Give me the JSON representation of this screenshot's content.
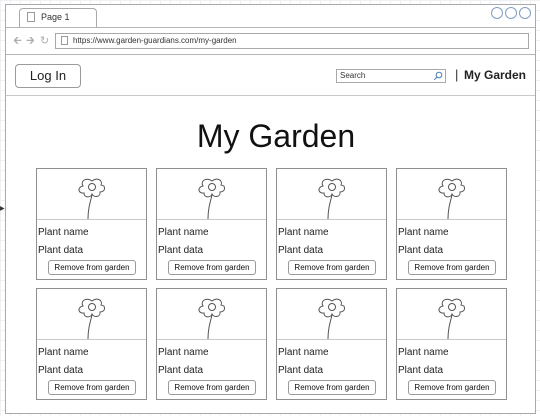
{
  "browser": {
    "tab_title": "Page 1",
    "url": "https://www.garden-guardians.com/my-garden",
    "nav_icons": [
      "back-arrow-icon",
      "forward-arrow-icon",
      "reload-icon"
    ]
  },
  "header": {
    "login_label": "Log In",
    "search_placeholder": "Search",
    "separator": "|",
    "title": "My Garden"
  },
  "page": {
    "title": "My Garden"
  },
  "cards": [
    {
      "name": "Plant name",
      "data": "Plant data",
      "button": "Remove from garden",
      "icon": "flower-icon"
    },
    {
      "name": "Plant name",
      "data": "Plant data",
      "button": "Remove from garden",
      "icon": "flower-icon"
    },
    {
      "name": "Plant name",
      "data": "Plant data",
      "button": "Remove from garden",
      "icon": "flower-icon"
    },
    {
      "name": "Plant name",
      "data": "Plant data",
      "button": "Remove from garden",
      "icon": "flower-icon"
    },
    {
      "name": "Plant name",
      "data": "Plant data",
      "button": "Remove from garden",
      "icon": "flower-icon"
    },
    {
      "name": "Plant name",
      "data": "Plant data",
      "button": "Remove from garden",
      "icon": "flower-icon"
    },
    {
      "name": "Plant name",
      "data": "Plant data",
      "button": "Remove from garden",
      "icon": "flower-icon"
    },
    {
      "name": "Plant name",
      "data": "Plant data",
      "button": "Remove from garden",
      "icon": "flower-icon"
    }
  ],
  "colors": {
    "border": "#8f8f8f",
    "window_control": "#7f9ec2",
    "text": "#222222"
  }
}
